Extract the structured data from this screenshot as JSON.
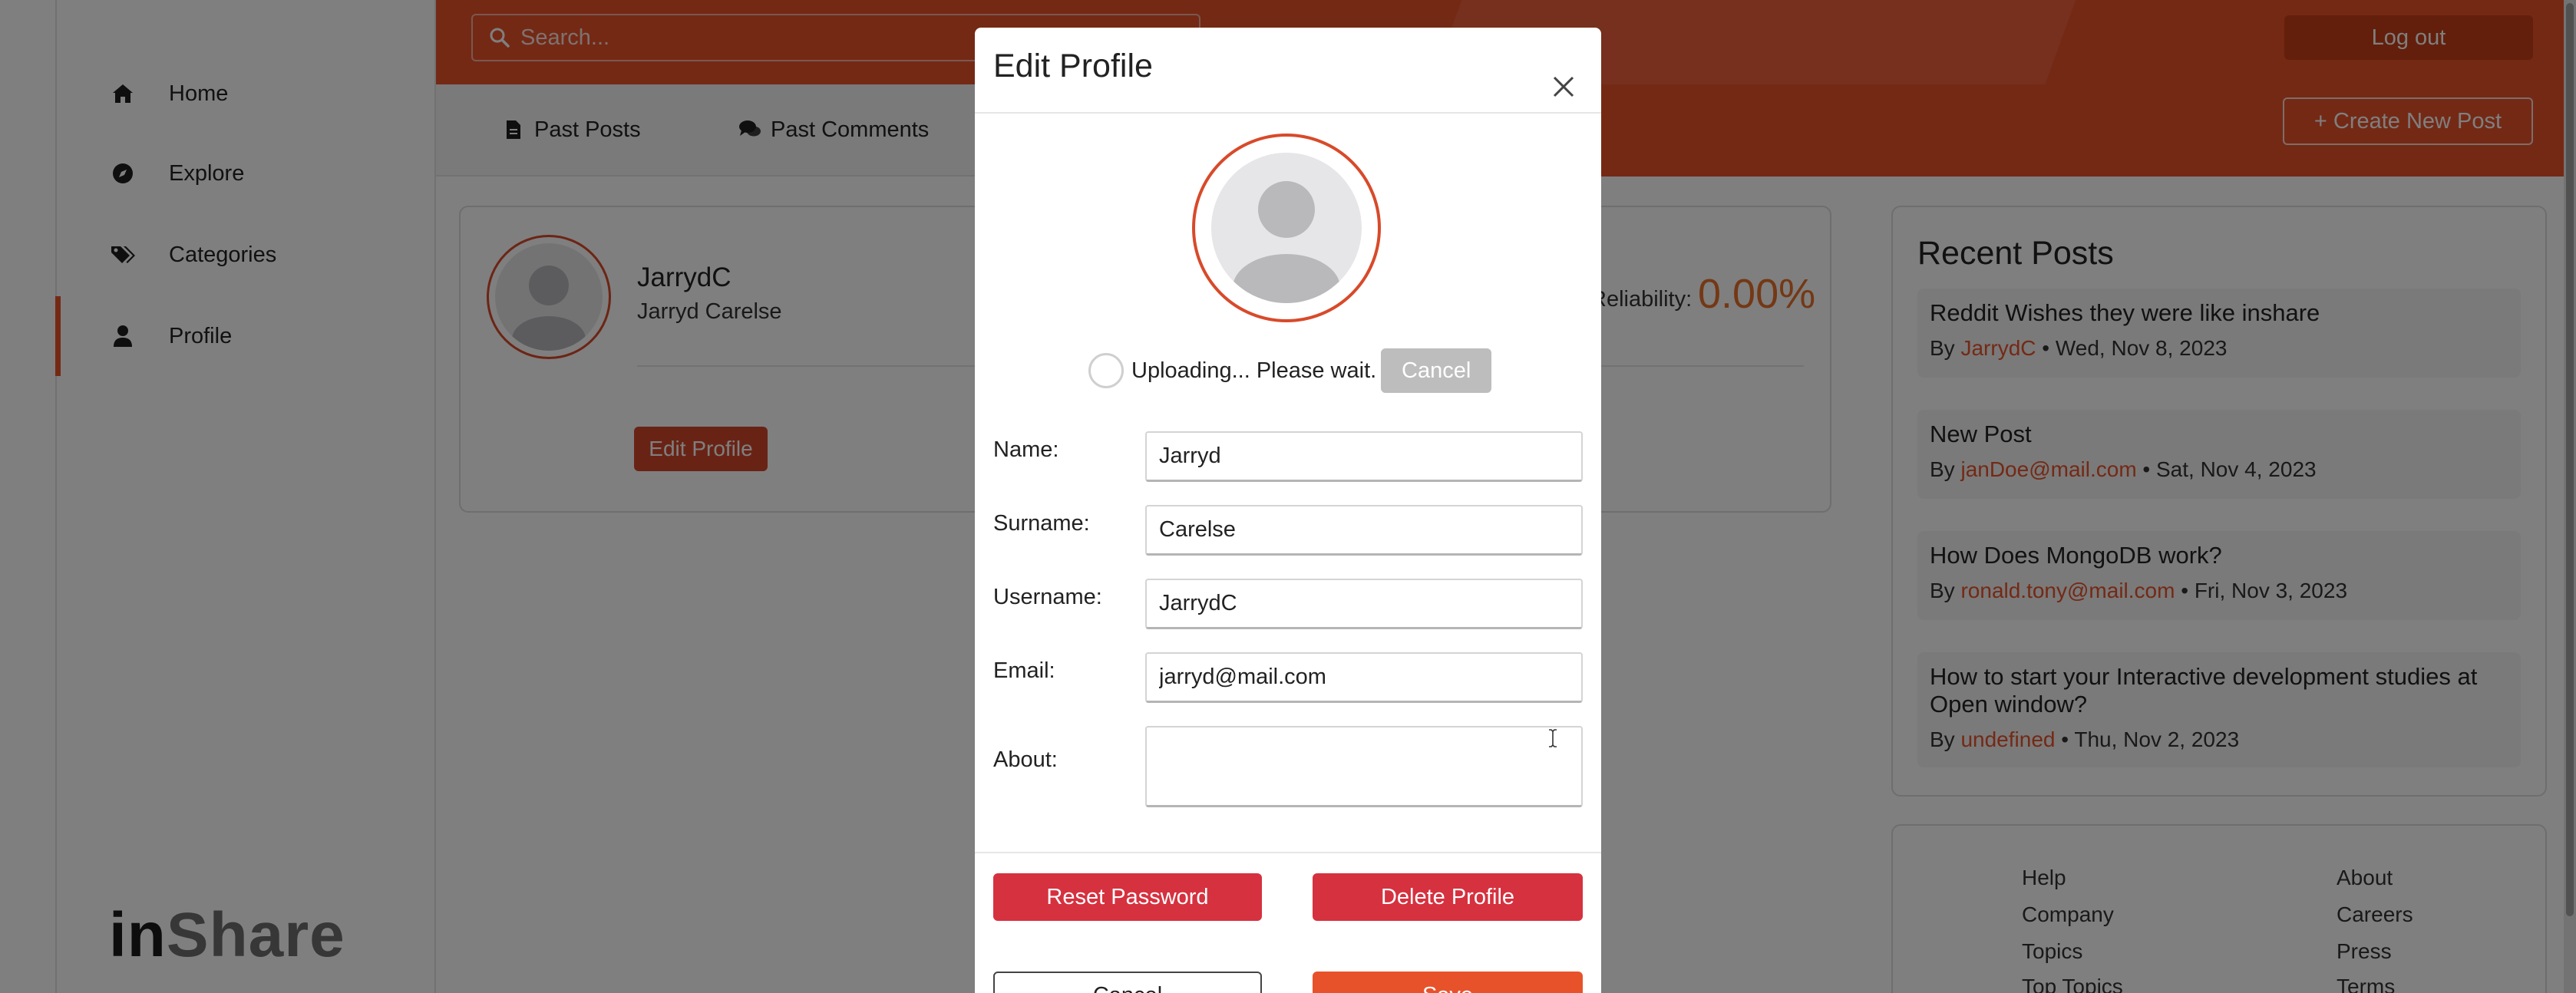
{
  "sidebar": {
    "items": [
      {
        "label": "Home",
        "icon": "home-icon"
      },
      {
        "label": "Explore",
        "icon": "compass-icon"
      },
      {
        "label": "Categories",
        "icon": "tags-icon"
      },
      {
        "label": "Profile",
        "icon": "user-icon",
        "active": true
      }
    ],
    "logo_in": "in",
    "logo_share": "Share"
  },
  "header": {
    "search_placeholder": "Search...",
    "logout_label": "Log out"
  },
  "tabs": {
    "past_posts": "Past Posts",
    "past_comments": "Past Comments",
    "create_post": "+ Create New Post"
  },
  "profile": {
    "username": "JarrydC",
    "full_name": "Jarryd Carelse",
    "reliability_label": "Reliability:",
    "reliability_value": "0.00%",
    "edit_label": "Edit Profile"
  },
  "recent": {
    "title": "Recent Posts",
    "posts": [
      {
        "title": "Reddit Wishes they were like inshare",
        "by": "By",
        "author": "JarrydC",
        "date": "• Wed, Nov 8, 2023"
      },
      {
        "title": "New Post",
        "by": "By",
        "author": "janDoe@mail.com",
        "date": "• Sat, Nov 4, 2023"
      },
      {
        "title": "How Does MongoDB work?",
        "by": "By",
        "author": "ronald.tony@mail.com",
        "date": "• Fri, Nov 3, 2023"
      },
      {
        "title": "How to start your Interactive development studies at Open window?",
        "by": "By",
        "author": "undefined",
        "date": "• Thu, Nov 2, 2023"
      }
    ]
  },
  "footer": {
    "links_left": [
      "Help",
      "Company",
      "Topics",
      "Top Topics"
    ],
    "links_right": [
      "About",
      "Careers",
      "Press",
      "Terms"
    ]
  },
  "modal": {
    "title": "Edit Profile",
    "upload_text": "Uploading... Please wait.",
    "upload_cancel": "Cancel",
    "fields": {
      "name_label": "Name:",
      "name_value": "Jarryd",
      "surname_label": "Surname:",
      "surname_value": "Carelse",
      "username_label": "Username:",
      "username_value": "JarrydC",
      "email_label": "Email:",
      "email_value": "jarryd@mail.com",
      "about_label": "About:",
      "about_value": ""
    },
    "reset_password": "Reset Password",
    "delete_profile": "Delete Profile",
    "cancel": "Cancel",
    "save": "Save"
  },
  "colors": {
    "brand": "#e8522b",
    "danger": "#d6313f",
    "reliability": "#e8702b"
  }
}
